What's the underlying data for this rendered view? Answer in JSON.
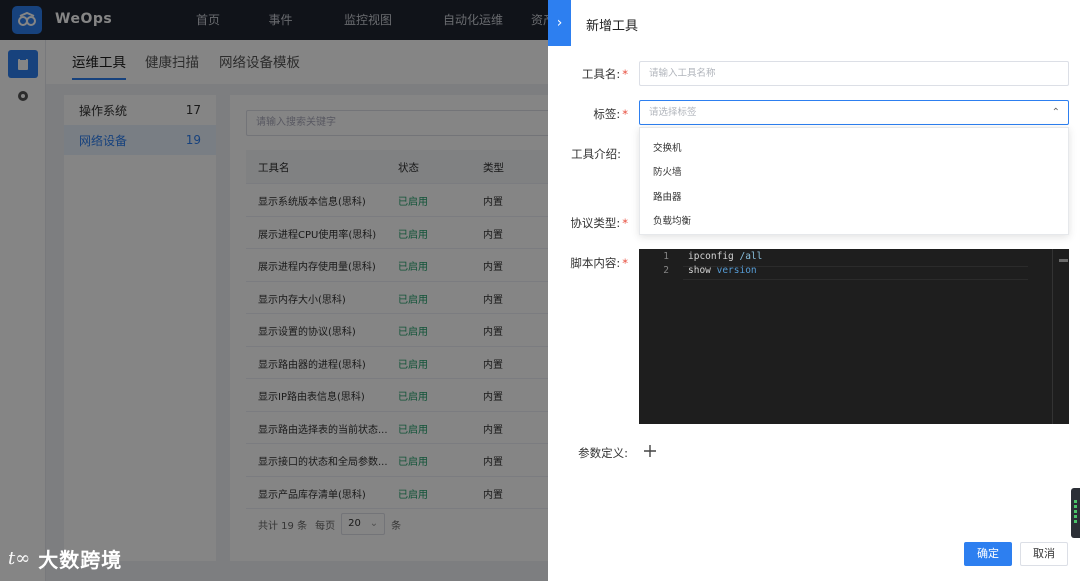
{
  "app": {
    "brand": "WeOps",
    "nav": [
      "首页",
      "事件",
      "监控视图",
      "自动化运维",
      "资产"
    ]
  },
  "tabs": [
    "运维工具",
    "健康扫描",
    "网络设备模板"
  ],
  "categories": [
    {
      "name": "操作系统",
      "count": "17"
    },
    {
      "name": "网络设备",
      "count": "19"
    }
  ],
  "search": {
    "placeholder": "请输入搜索关键字"
  },
  "table": {
    "headers": [
      "工具名",
      "状态",
      "类型"
    ],
    "rows": [
      {
        "name": "显示系统版本信息(思科)",
        "status": "已启用",
        "type": "内置"
      },
      {
        "name": "展示进程CPU使用率(思科)",
        "status": "已启用",
        "type": "内置"
      },
      {
        "name": "展示进程内存使用量(思科)",
        "status": "已启用",
        "type": "内置"
      },
      {
        "name": "显示内存大小(思科)",
        "status": "已启用",
        "type": "内置"
      },
      {
        "name": "显示设置的协议(思科)",
        "status": "已启用",
        "type": "内置"
      },
      {
        "name": "显示路由器的进程(思科)",
        "status": "已启用",
        "type": "内置"
      },
      {
        "name": "显示IP路由表信息(思科)",
        "status": "已启用",
        "type": "内置"
      },
      {
        "name": "显示路由选择表的当前状态...",
        "status": "已启用",
        "type": "内置"
      },
      {
        "name": "显示接口的状态和全局参数...",
        "status": "已启用",
        "type": "内置"
      },
      {
        "name": "显示产品库存清单(思科)",
        "status": "已启用",
        "type": "内置"
      }
    ]
  },
  "pager": {
    "total": "共计 19 条",
    "per_page": "每页",
    "size": "20",
    "unit": "条"
  },
  "watermark": {
    "mark": "t∞",
    "text": "大数跨境"
  },
  "drawer": {
    "collapse": "›",
    "title": "新增工具",
    "fields": {
      "name_label": "工具名:",
      "name_placeholder": "请输入工具名称",
      "tag_label": "标签:",
      "tag_placeholder": "请选择标签",
      "intro_label": "工具介绍:",
      "protocol_label": "协议类型:",
      "script_label": "脚本内容:",
      "params_label": "参数定义:"
    },
    "tag_options": [
      "交换机",
      "防火墙",
      "路由器",
      "负载均衡"
    ],
    "code": [
      {
        "ln": "1",
        "text": "ipconfig",
        "arg": " /all"
      },
      {
        "ln": "2",
        "text": "show",
        "arg": " version"
      }
    ],
    "ok": "确定",
    "cancel": "取消"
  }
}
